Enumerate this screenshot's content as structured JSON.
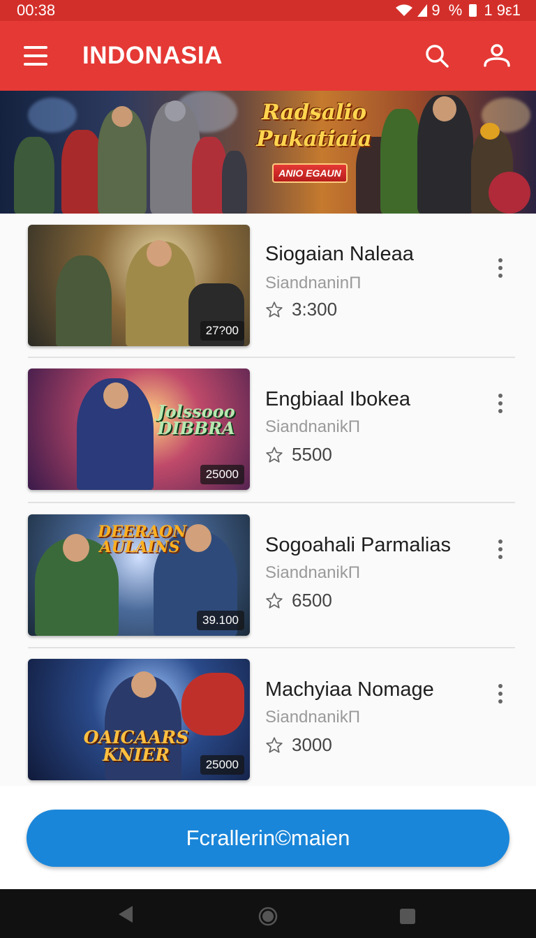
{
  "status_bar": {
    "time": "00:38",
    "signal": "9 %",
    "extra": "1 9ε1"
  },
  "app_bar": {
    "title": "INDONASIA"
  },
  "banner": {
    "title_line1": "Radsalio",
    "title_line2": "Pukatiaia",
    "button_label": "ANIO EGAUN"
  },
  "games": [
    {
      "title": "Siogaian Naleaa",
      "subtitle": "SiandnaninΠ",
      "rating": "3:300",
      "badge": "27?00",
      "logo": ""
    },
    {
      "title": "Engbiaal Ibokea",
      "subtitle": "SiandnanikΠ",
      "rating": "5500",
      "badge": "25000",
      "logo": "Jolssooo DIBBRA"
    },
    {
      "title": "Sogoahali Parmalias",
      "subtitle": "SiandnanikΠ",
      "rating": "6500",
      "badge": "39.100",
      "logo": "DEERAON AULAINS"
    },
    {
      "title": "Machyiaa Nomage",
      "subtitle": "SiandnanikΠ",
      "rating": "3000",
      "badge": "25000",
      "logo": "OAICAARS KNIER"
    }
  ],
  "cta": {
    "label": "Fcrallerin©maien"
  },
  "icons": {
    "menu": "menu-icon",
    "search": "search-icon",
    "profile": "profile-icon",
    "star": "star-icon",
    "more": "more-vert-icon"
  },
  "colors": {
    "primary": "#e53935",
    "status": "#d32f2a",
    "accent": "#1a86d9"
  }
}
